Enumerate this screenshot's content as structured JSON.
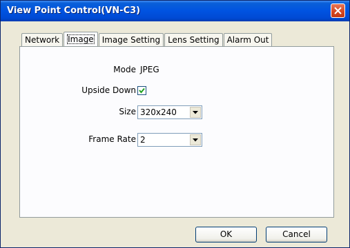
{
  "window": {
    "title": "View Point Control(VN-C3)"
  },
  "tabs": [
    {
      "label": "Network"
    },
    {
      "label": "Image"
    },
    {
      "label": "Image Setting"
    },
    {
      "label": "Lens Setting"
    },
    {
      "label": "Alarm Out"
    }
  ],
  "active_tab": "Image",
  "form": {
    "mode": {
      "label": "Mode",
      "value": "JPEG"
    },
    "upside_down": {
      "label": "Upside Down",
      "checked": true
    },
    "size": {
      "label": "Size",
      "value": "320x240"
    },
    "frame_rate": {
      "label": "Frame Rate",
      "value": "2"
    }
  },
  "buttons": {
    "ok": "OK",
    "cancel": "Cancel"
  },
  "icons": {
    "close": "close-icon",
    "check": "checkmark-icon",
    "dropdown": "chevron-down-icon"
  },
  "colors": {
    "title_bar": "#0053e1",
    "close_button": "#d4451f",
    "dialog_bg": "#ece9d8"
  }
}
